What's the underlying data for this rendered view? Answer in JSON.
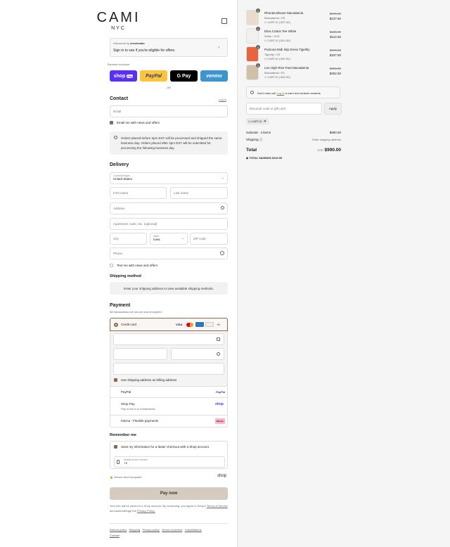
{
  "brand": {
    "name": "CAMI",
    "sub": "NYC"
  },
  "banner": {
    "discounts_by": "Discounts by",
    "provider": "checkmate",
    "text": "Sign in to see if you're eligible for offers."
  },
  "express": {
    "label": "Express checkout",
    "shop": "shop",
    "shop_pay": "Pay",
    "paypal": "PayPal",
    "gpay": "G Pay",
    "venmo": "venmo",
    "or": "OR"
  },
  "contact": {
    "title": "Contact",
    "login": "Log in",
    "email_placeholder": "Email",
    "news": "Email me with news and offers",
    "notice": "Orders placed before 2pm EST will be processed and shipped the same business day. Orders placed after 2pm EST will be submitted for processing the following business day."
  },
  "delivery": {
    "title": "Delivery",
    "country_label": "Country/Region",
    "country": "United States",
    "first": "First name",
    "last": "Last name",
    "address": "Address",
    "apt": "Apartment, suite, etc. (optional)",
    "city": "City",
    "state_label": "State",
    "state": "Iowa",
    "zip": "ZIP code",
    "phone": "Phone",
    "text_news": "Text me with news and offers"
  },
  "shipping": {
    "title": "Shipping method",
    "note": "Enter your shipping address to view available shipping methods."
  },
  "payment": {
    "title": "Payment",
    "subtitle": "All transactions are secure and encrypted.",
    "credit": "Credit card",
    "more": "+5",
    "billing": "Use shipping address as billing address",
    "paypal": "PayPal",
    "shoppay": "Shop Pay",
    "shoppay_sub": "Pay in full or in installments",
    "shop_logo": "shop",
    "klarna": "Klarna - Flexible payments",
    "klarna_logo": "Klarna."
  },
  "remember": {
    "title": "Remember me",
    "save": "Save my information for a faster checkout with a Shop account",
    "mobile_label": "Mobile phone number",
    "mobile_value": "+1",
    "secure": "Secure and encrypted",
    "shop": "shop"
  },
  "paynow": "Pay now",
  "legal": {
    "line1": "Your info will be saved to a Shop account. By continuing, you agree to Shop's",
    "tos": "Terms of Service",
    "and": "and acknowledge the",
    "privacy": "Privacy Policy."
  },
  "footer": [
    "Refund policy",
    "Shipping",
    "Privacy policy",
    "Terms of service",
    "Cancellations",
    "Contact"
  ],
  "items": [
    {
      "qty": "1",
      "name": "Rhonda Blouse Macadamia",
      "variant": "Macadamia / XS",
      "code": "CART10 (-$27.50)",
      "old": "$275.00",
      "price": "$247.50",
      "color": "#e9dccb"
    },
    {
      "qty": "1",
      "name": "Ebra Cotton Tee White",
      "variant": "White / XXS",
      "code": "CART10 (-$12.50)",
      "old": "$125.00",
      "price": "$112.50",
      "color": "#f1f0ec"
    },
    {
      "qty": "1",
      "name": "Pomona Midi Slip Dress Tigerlily",
      "variant": "Tigerlily / XS",
      "code": "CART10 (-$37.50)",
      "old": "$375.00",
      "price": "$337.50",
      "color": "#e8643c"
    },
    {
      "qty": "1",
      "name": "Leo High Rise Pant Macadamia",
      "variant": "Macadamia / 00",
      "code": "CART10 (-$32.50)",
      "old": "$325.00",
      "price": "$292.50",
      "color": "#cfc1a8"
    }
  ],
  "rewards": {
    "pre": "Don't miss out!",
    "link": "Log in",
    "post": "to earn and redeem rewards"
  },
  "discount": {
    "placeholder": "Discount code or gift card",
    "apply": "Apply",
    "tag": "CART10"
  },
  "summary": {
    "subtotal_label": "Subtotal · 4 items",
    "subtotal": "$990.00",
    "shipping_label": "Shipping",
    "shipping": "Enter shipping address",
    "total_label": "Total",
    "currency": "USD",
    "total": "$990.00",
    "savings_label": "TOTAL SAVINGS",
    "savings": "$110.00"
  }
}
